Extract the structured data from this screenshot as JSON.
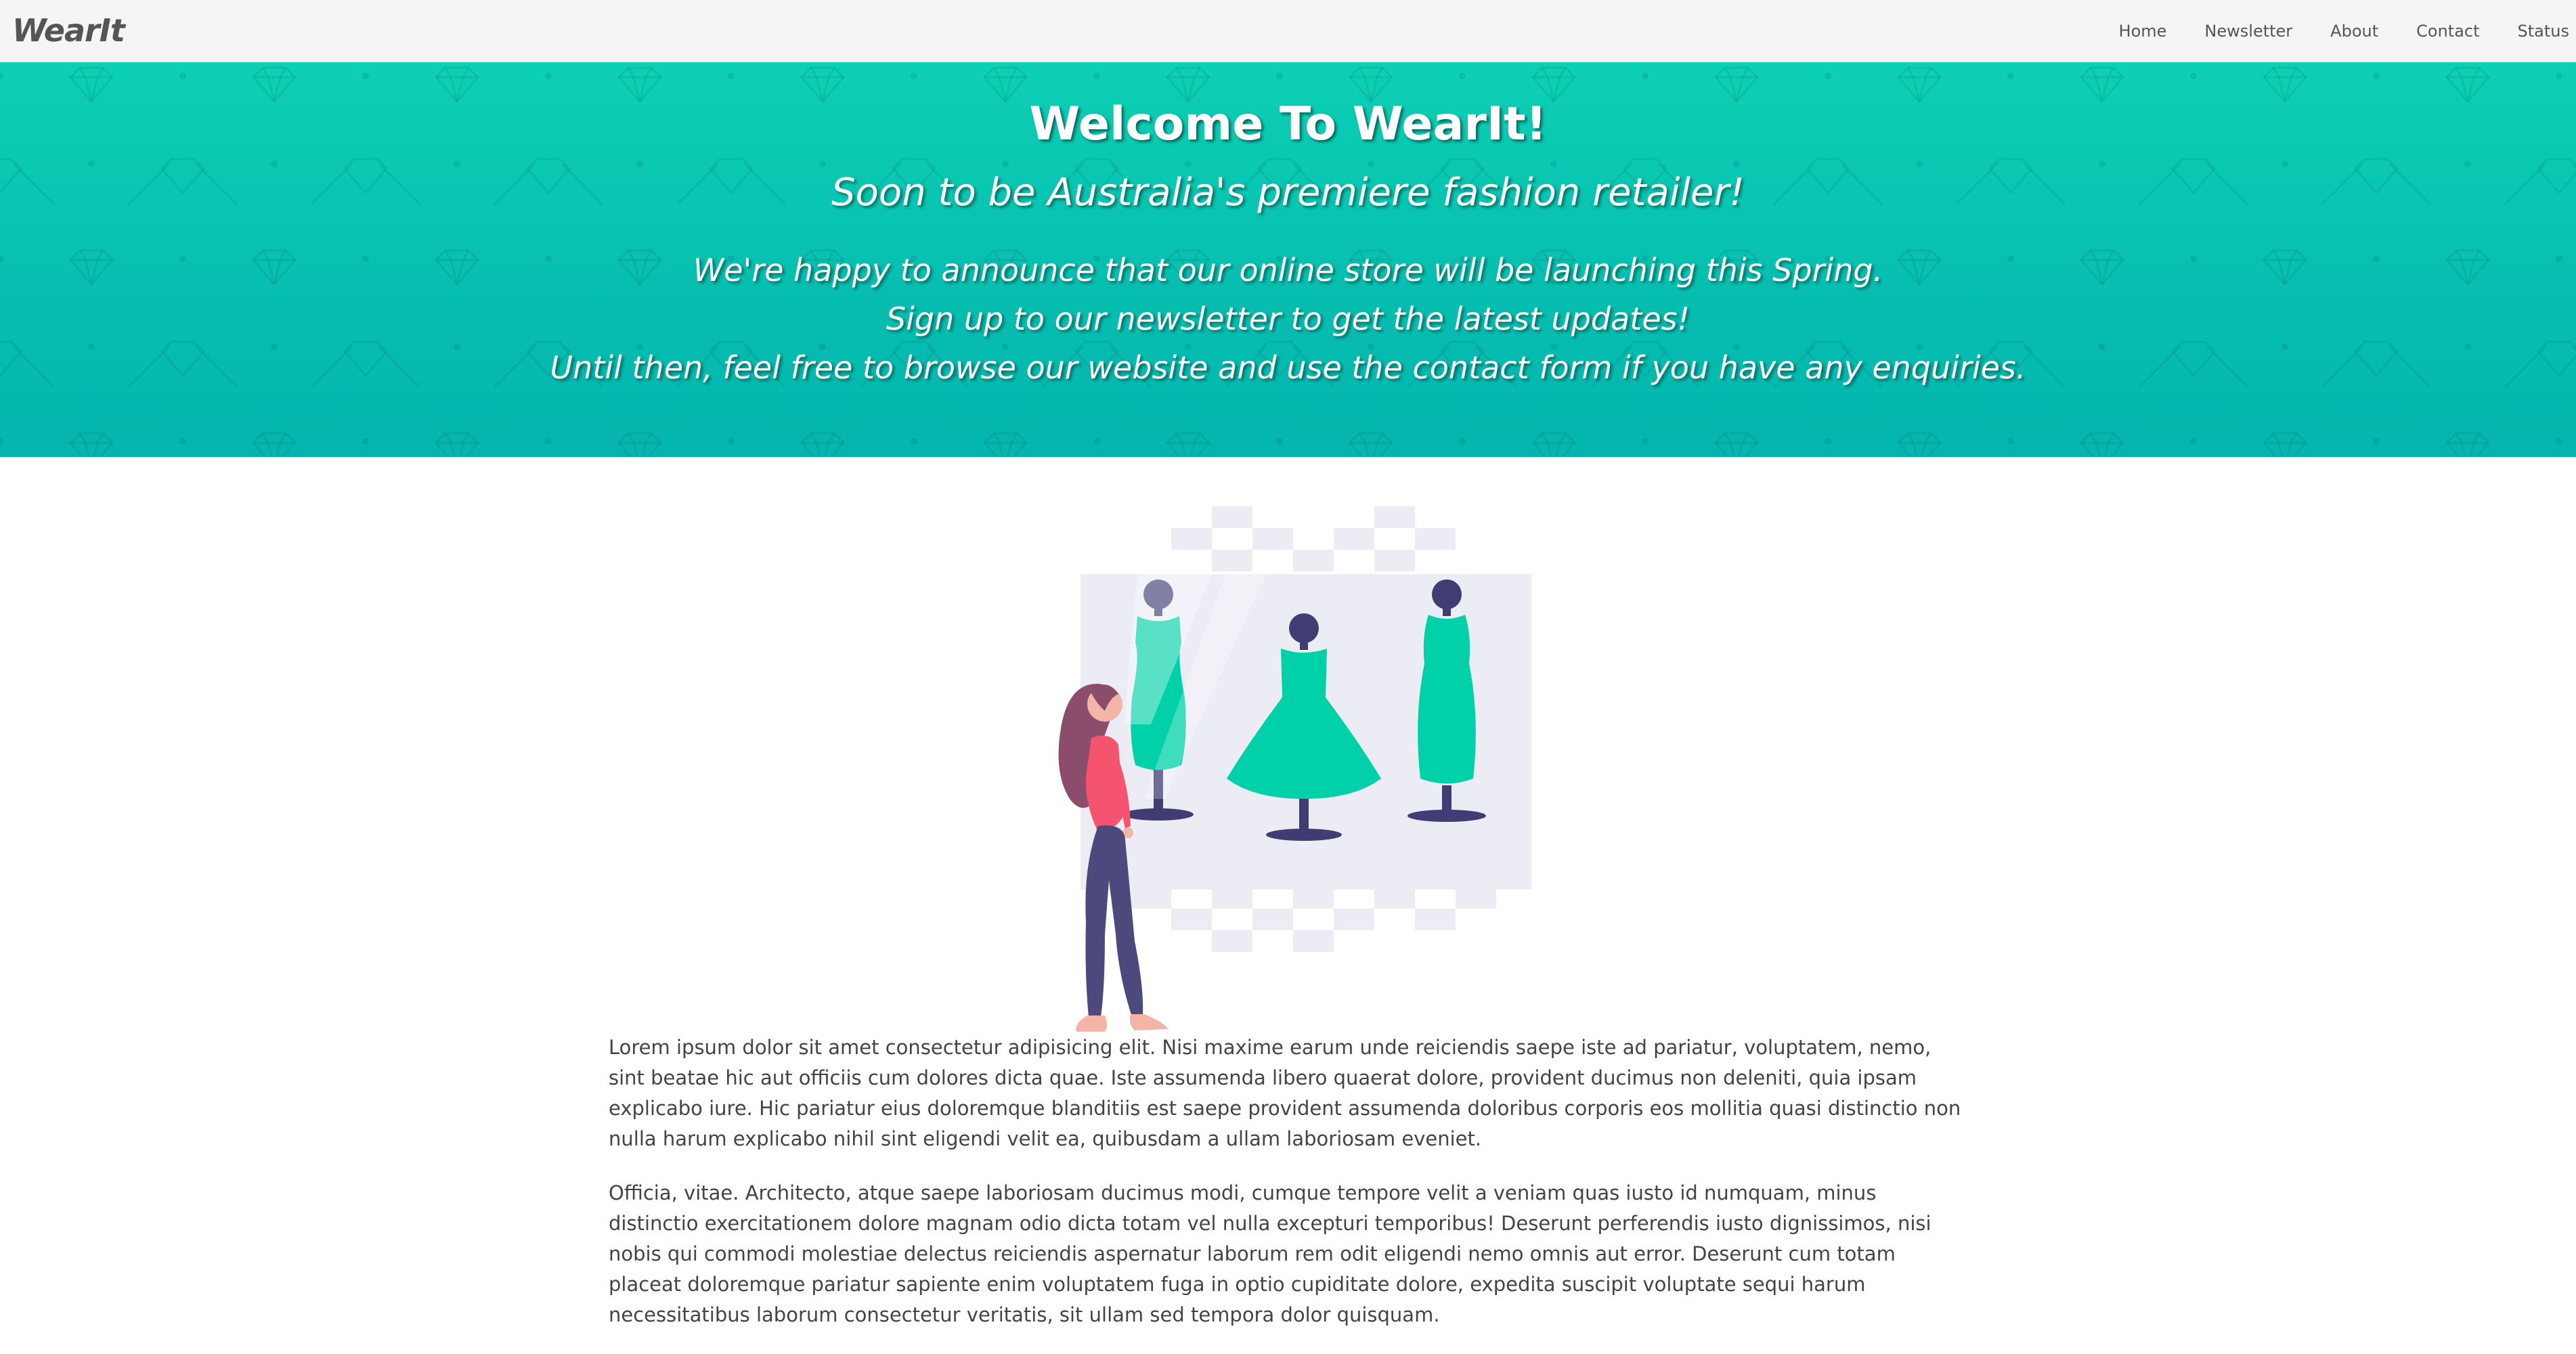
{
  "navbar": {
    "brand": "WearIt",
    "links": [
      "Home",
      "Newsletter",
      "About",
      "Contact",
      "Status"
    ]
  },
  "hero": {
    "title": "Welcome To WearIt!",
    "subtitle": "Soon to be Australia's premiere fashion retailer!",
    "lines": [
      "We're happy to announce that our online store will be launching this Spring.",
      "Sign up to our newsletter to get the latest updates!",
      "Until then, feel free to browse our website and use the contact form if you have any enquiries."
    ]
  },
  "illustration": {
    "icon": "shop-window-dresses-illustration"
  },
  "content": {
    "paragraphs": [
      "Lorem ipsum dolor sit amet consectetur adipisicing elit. Nisi maxime earum unde reiciendis saepe iste ad pariatur, voluptatem, nemo, sint beatae hic aut officiis cum dolores dicta quae. Iste assumenda libero quaerat dolore, provident ducimus non deleniti, quia ipsam explicabo iure. Hic pariatur eius doloremque blanditiis est saepe provident assumenda doloribus corporis eos mollitia quasi distinctio non nulla harum explicabo nihil sint eligendi velit ea, quibusdam a ullam laboriosam eveniet.",
      "Officia, vitae. Architecto, atque saepe laboriosam ducimus modi, cumque tempore velit a veniam quas iusto id numquam, minus distinctio exercitationem dolore magnam odio dicta totam vel nulla excepturi temporibus! Deserunt perferendis iusto dignissimos, nisi nobis qui commodi molestiae delectus reiciendis aspernatur laborum rem odit eligendi nemo omnis aut error. Deserunt cum totam placeat doloremque pariatur sapiente enim voluptatem fuga in optio cupiditate dolore, expedita suscipit voluptate sequi harum necessitatibus laborum consectetur veritatis, sit ullam sed tempora dolor quisquam."
    ]
  },
  "colors": {
    "hero_top": "#0cd0b4",
    "hero_bottom": "#03b5ae",
    "dress": "#00d1a9",
    "mannequin": "#3f3d74",
    "shirt": "#f5546f",
    "hair": "#8b4d6b",
    "pants": "#4c4a7d",
    "window_bg": "#ecedf4"
  }
}
